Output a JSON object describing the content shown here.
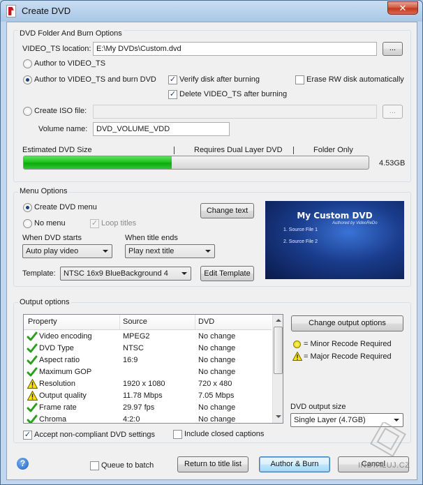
{
  "window": {
    "title": "Create DVD",
    "close_glyph": "✕"
  },
  "burn_options": {
    "group_label": "DVD Folder And Burn Options",
    "video_ts_label": "VIDEO_TS location:",
    "video_ts_value": "E:\\My DVDs\\Custom.dvd",
    "browse_label": "...",
    "author_video_ts": "Author to VIDEO_TS",
    "author_and_burn": "Author to VIDEO_TS and burn DVD",
    "verify_after_burning": "Verify disk after burning",
    "erase_rw": "Erase RW disk automatically",
    "delete_after_burning": "Delete VIDEO_TS after burning",
    "create_iso": "Create ISO file:",
    "iso_value": "",
    "iso_browse_label": "...",
    "volume_name_label": "Volume name:",
    "volume_name_value": "DVD_VOLUME_VDD",
    "estimated_size_label": "Estimated DVD Size",
    "dual_layer_label": "Requires Dual Layer DVD",
    "folder_only_label": "Folder Only",
    "size_value": "4.53GB",
    "size_fill_percent": 43
  },
  "menu_options": {
    "group_label": "Menu Options",
    "create_menu": "Create DVD menu",
    "no_menu": "No menu",
    "loop_titles": "Loop titles",
    "change_text": "Change text",
    "when_dvd_starts_label": "When DVD starts",
    "when_dvd_starts_value": "Auto play video",
    "when_title_ends_label": "When title ends",
    "when_title_ends_value": "Play next title",
    "template_label": "Template:",
    "template_value": "NTSC 16x9 BlueBackground 4",
    "edit_template": "Edit Template",
    "preview": {
      "title": "My Custom DVD",
      "subtitle": "Authored by VideoReDo",
      "items": [
        "1. Source File 1",
        "2. Source File 2"
      ]
    }
  },
  "output_options": {
    "group_label": "Output options",
    "columns": [
      "Property",
      "Source",
      "DVD"
    ],
    "rows": [
      {
        "status": "ok",
        "property": "Video encoding",
        "source": "MPEG2",
        "dvd": "No change"
      },
      {
        "status": "ok",
        "property": "DVD Type",
        "source": "NTSC",
        "dvd": "No change"
      },
      {
        "status": "ok",
        "property": "Aspect ratio",
        "source": "16:9",
        "dvd": "No change"
      },
      {
        "status": "ok",
        "property": "Maximum GOP",
        "source": "",
        "dvd": "No change"
      },
      {
        "status": "major",
        "property": "Resolution",
        "source": "1920 x 1080",
        "dvd": "720 x 480"
      },
      {
        "status": "minor",
        "property": "Output quality",
        "source": "11.78 Mbps",
        "dvd": "7.05 Mbps"
      },
      {
        "status": "ok",
        "property": "Frame rate",
        "source": "29.97 fps",
        "dvd": "No change"
      },
      {
        "status": "ok",
        "property": "Chroma",
        "source": "4:2:0",
        "dvd": "No change"
      }
    ],
    "change_output_options": "Change output options",
    "minor_recode": "= Minor Recode Required",
    "major_recode": "= Major Recode Required",
    "output_size_label": "DVD output size",
    "output_size_value": "Single Layer (4.7GB)",
    "accept_noncompliant": "Accept non-compliant DVD settings",
    "include_captions": "Include closed captions"
  },
  "footer": {
    "help_glyph": "?",
    "queue_to_batch": "Queue to batch",
    "return_to_title_list": "Return to title list",
    "author_burn": "Author & Burn",
    "cancel": "Cancel"
  },
  "watermark": {
    "text": "INSTALUJ.CZ"
  },
  "colors": {
    "progress_green": "#1ec41e",
    "dvd_blue": "#1a3c8c",
    "warning_yellow": "#ffe600",
    "check_green": "#2aa01a"
  }
}
